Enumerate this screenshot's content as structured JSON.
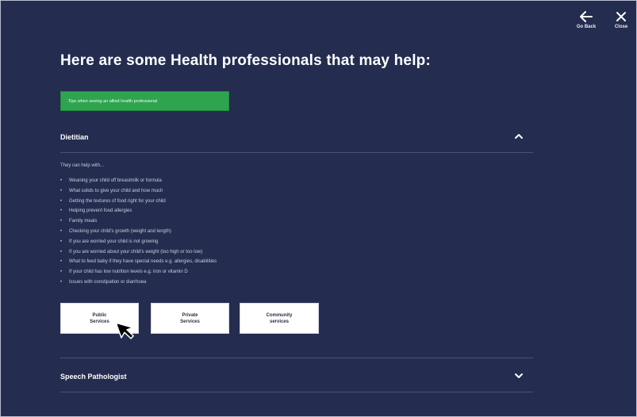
{
  "header": {
    "back_label": "Go Back",
    "close_label": "Close",
    "back_icon": "arrow-left-icon",
    "close_icon": "close-icon"
  },
  "page_title": "Here are some Health professionals that may help:",
  "tips_button": {
    "label": "Tips when seeing an allied health professional",
    "color": "#2ea44f"
  },
  "accordions": [
    {
      "title": "Dietitian",
      "expanded": true,
      "icon": "chevron-up-icon",
      "intro": "They can help with...",
      "items": [
        "Weaning your child off breastmilk or formula",
        "What solids to give your child and how much",
        "Getting the textures of food right for your child",
        "Helping prevent food allergies",
        "Family meals",
        "Checking your child's growth (weight and length)",
        "If you are worried your child is not growing",
        "If you are worried about your child's weight (too high or too low)",
        "What to feed baby if they have special needs e.g. allergies, disabilities",
        "If your child has low nutrition levels e.g. iron or vitamin D",
        "Issues with constipation or diarrhoea"
      ],
      "services": [
        {
          "line1": "Public",
          "line2": "Services"
        },
        {
          "line1": "Private",
          "line2": "Services"
        },
        {
          "line1": "Community",
          "line2": "services"
        }
      ]
    },
    {
      "title": "Speech Pathologist",
      "expanded": false,
      "icon": "chevron-down-icon"
    }
  ],
  "colors": {
    "background": "#242d4f",
    "accent_green": "#2ea44f",
    "button_bg": "#ffffff"
  }
}
